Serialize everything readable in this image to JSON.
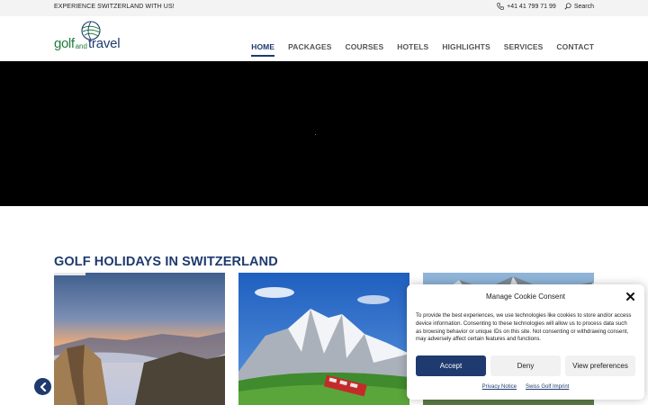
{
  "topbar": {
    "tagline": "EXPERIENCE SWITZERLAND WITH US!",
    "phone": "+41 41 799 71 99",
    "search_label": "Search"
  },
  "logo": {
    "golf": "golf",
    "and": "and",
    "travel": "travel"
  },
  "nav": {
    "items": [
      "HOME",
      "PACKAGES",
      "COURSES",
      "HOTELS",
      "HIGHLIGHTS",
      "SERVICES",
      "CONTACT"
    ],
    "active": "HOME"
  },
  "section": {
    "title": "GOLF HOLIDAYS IN SWITZERLAND"
  },
  "cookie": {
    "title": "Manage Cookie Consent",
    "text": "To provide the best experiences, we use technologies like cookies to store and/or access device information. Consenting to these technologies will allow us to process data such as browsing behavior or unique IDs on this site. Not consenting or withdrawing consent, may adversely affect certain features and functions.",
    "accept": "Accept",
    "deny": "Deny",
    "preferences": "View preferences",
    "privacy_link": "Privacy Notice",
    "imprint_link": "Swiss Golf Imprint"
  },
  "colors": {
    "brand_navy": "#1e3a6e",
    "brand_green": "#1e7d3b",
    "hero_bg": "#000000"
  }
}
